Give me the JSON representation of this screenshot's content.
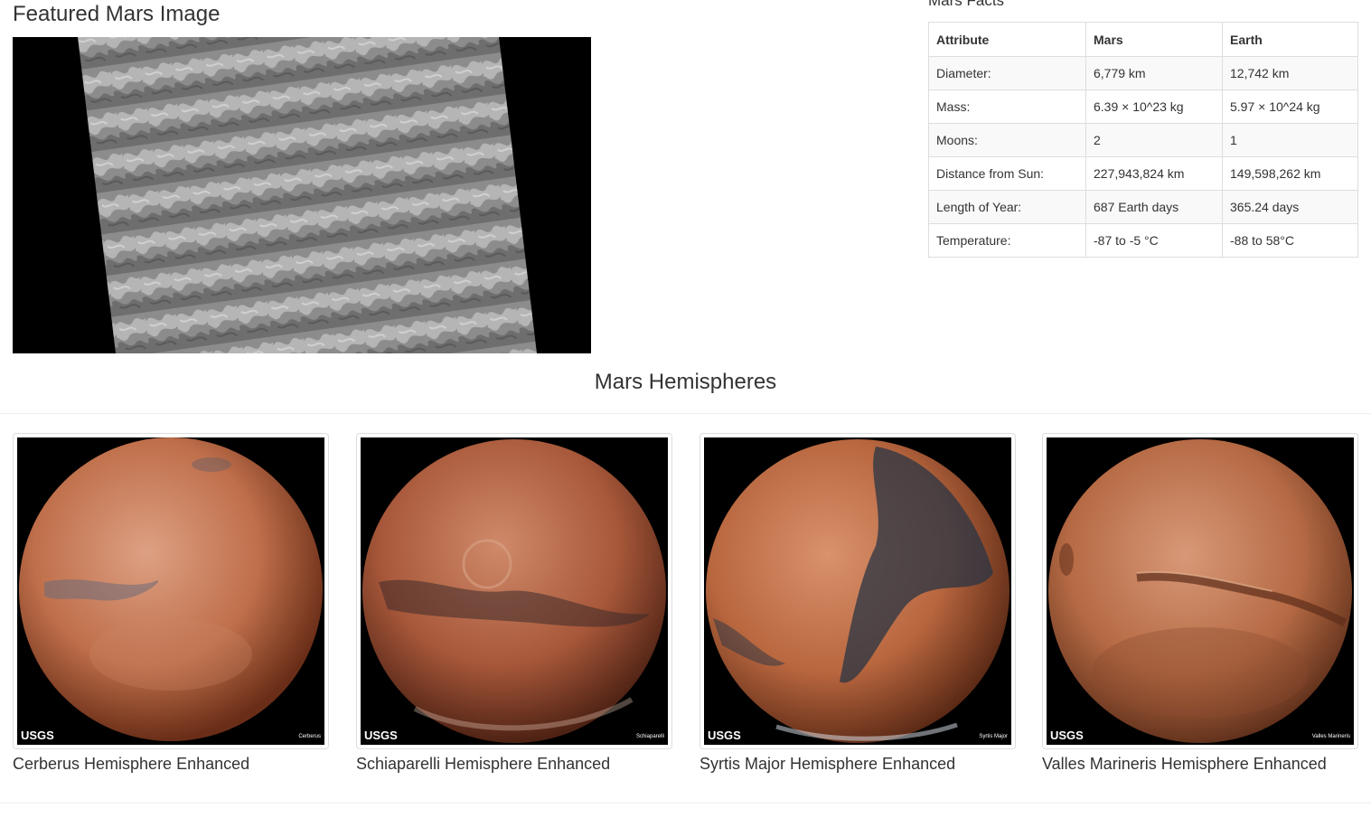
{
  "featured": {
    "title": "Featured Mars Image"
  },
  "facts": {
    "title": "Mars Facts",
    "columns": [
      "Attribute",
      "Mars",
      "Earth"
    ],
    "rows": [
      [
        "Diameter:",
        "6,779 km",
        "12,742 km"
      ],
      [
        "Mass:",
        "6.39 × 10^23 kg",
        "5.97 × 10^24 kg"
      ],
      [
        "Moons:",
        "2",
        "1"
      ],
      [
        "Distance from Sun:",
        "227,943,824 km",
        "149,598,262 km"
      ],
      [
        "Length of Year:",
        "687 Earth days",
        "365.24 days"
      ],
      [
        "Temperature:",
        "-87 to -5 °C",
        "-88 to 58°C"
      ]
    ]
  },
  "hemispheres": {
    "title": "Mars Hemispheres",
    "items": [
      {
        "caption": "Cerberus Hemisphere Enhanced",
        "label": "Cerberus",
        "logo": "USGS"
      },
      {
        "caption": "Schiaparelli Hemisphere Enhanced",
        "label": "Schiaparelli",
        "logo": "USGS"
      },
      {
        "caption": "Syrtis Major Hemisphere Enhanced",
        "label": "Syrtis Major",
        "logo": "USGS"
      },
      {
        "caption": "Valles Marineris Hemisphere Enhanced",
        "label": "Valles Marineris",
        "logo": "USGS"
      }
    ]
  },
  "colors": {
    "mars_light": "#d99070",
    "mars_mid": "#b8653f",
    "mars_dark": "#5a2a18",
    "dune_gray": "#8a8a8a"
  }
}
